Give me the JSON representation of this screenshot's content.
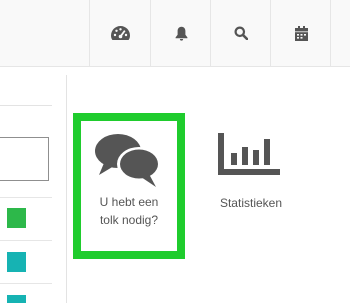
{
  "toolbar": {
    "buttons": [
      {
        "name": "dashboard",
        "icon": "speedometer-icon"
      },
      {
        "name": "notifications",
        "icon": "bell-icon"
      },
      {
        "name": "search",
        "icon": "search-icon"
      },
      {
        "name": "calendar",
        "icon": "calendar-icon"
      }
    ]
  },
  "tiles": [
    {
      "label": "U hebt een\ntolk nodig?",
      "icon": "chat-bubbles-icon",
      "selected": true
    },
    {
      "label": "Statistieken",
      "icon": "bar-chart-icon",
      "selected": false
    }
  ],
  "colors": {
    "selected_border": "#1fcc2d",
    "icon_gray": "#555555",
    "status_green": "#2db84a",
    "status_teal": "#16b3b3"
  },
  "left_panel": {
    "status_squares": [
      "green",
      "teal",
      "teal"
    ]
  }
}
